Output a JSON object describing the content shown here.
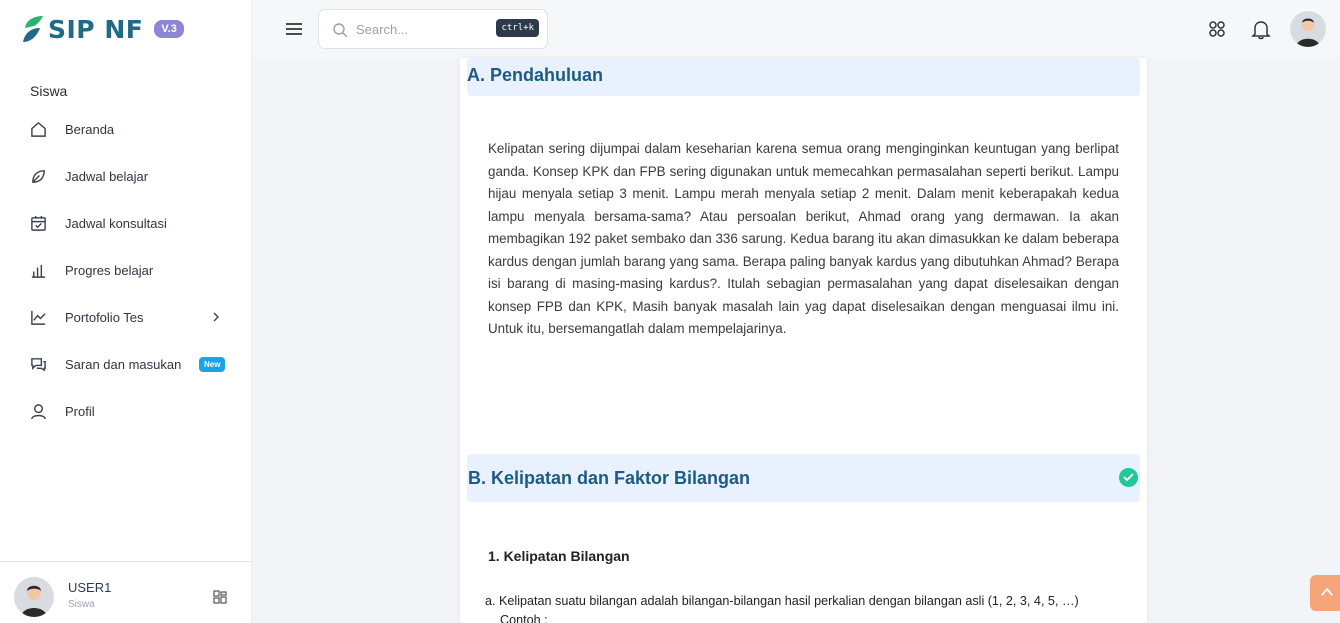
{
  "brand": {
    "name": "SIP NF",
    "version": "V.3"
  },
  "sidebar": {
    "section_title": "Siswa",
    "items": [
      {
        "label": "Beranda",
        "icon": "home-icon"
      },
      {
        "label": "Jadwal belajar",
        "icon": "leaf-icon"
      },
      {
        "label": "Jadwal konsultasi",
        "icon": "calendar-check-icon"
      },
      {
        "label": "Progres belajar",
        "icon": "bar-chart-icon"
      },
      {
        "label": "Portofolio Tes",
        "icon": "line-chart-icon"
      },
      {
        "label": "Saran dan masukan",
        "icon": "chat-icon",
        "badge": "New"
      },
      {
        "label": "Profil",
        "icon": "user-icon"
      }
    ],
    "user": {
      "name": "USER1",
      "role": "Siswa"
    }
  },
  "topbar": {
    "search_placeholder": "Search...",
    "search_shortcut": "ctrl+k"
  },
  "content": {
    "section_a_title": "A. Pendahuluan",
    "intro_paragraph": "Kelipatan sering dijumpai dalam keseharian karena semua orang menginginkan keuntugan yang berlipat ganda. Konsep KPK dan FPB  sering digunakan untuk memecahkan permasalahan seperti berikut. Lampu hijau menyala setiap 3 menit. Lampu merah menyala setiap 2 menit. Dalam menit keberapakah kedua lampu menyala bersama-sama?  Atau persoalan berikut, Ahmad orang yang dermawan. Ia akan membagikan 192 paket sembako dan 336 sarung. Kedua barang itu akan dimasukkan ke dalam beberapa kardus dengan jumlah barang yang sama. Berapa paling banyak kardus yang dibutuhkan Ahmad? Berapa isi barang di masing-masing kardus?. Itulah sebagian permasalahan yang dapat diselesaikan dengan konsep FPB dan KPK, Masih banyak masalah lain yag dapat diselesaikan dengan menguasai ilmu ini. Untuk itu, bersemangatlah dalam mempelajarinya.",
    "section_b_title": "B. Kelipatan dan Faktor Bilangan",
    "sub_heading": "1.  Kelipatan Bilangan",
    "list_a": "a. Kelipatan suatu bilangan adalah bilangan-bilangan hasil perkalian dengan bilangan asli (1, 2, 3, 4, 5, …)",
    "list_a_cont": "Contoh :"
  },
  "colors": {
    "brand_blue": "#1f6b86",
    "section_header_bg": "#e8f1fd",
    "section_title": "#1c5b84",
    "check_green": "#20c997",
    "new_badge": "#1aa3e8",
    "scroll_top": "#f6a57a"
  }
}
